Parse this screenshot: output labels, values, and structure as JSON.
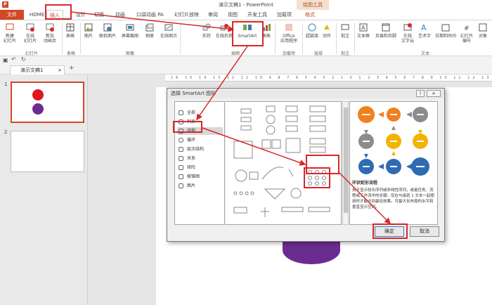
{
  "window": {
    "title": "演示文稿1 - PowerPoint",
    "context_tab_group": "绘图工具"
  },
  "tabs": [
    {
      "label": "文件"
    },
    {
      "label": "HOME"
    },
    {
      "label": "插入"
    },
    {
      "label": "设计"
    },
    {
      "label": "切换"
    },
    {
      "label": "动画"
    },
    {
      "label": "口袋动画 PA"
    },
    {
      "label": "幻灯片放映"
    },
    {
      "label": "审阅"
    },
    {
      "label": "视图"
    },
    {
      "label": "开发工具"
    },
    {
      "label": "加载项"
    },
    {
      "label": "格式"
    }
  ],
  "ribbon": {
    "buttons": [
      {
        "label": "新建\n幻灯片"
      },
      {
        "label": "在线\n幻灯片"
      },
      {
        "label": "新加\n动画页"
      },
      {
        "label": "表格"
      },
      {
        "label": "图片"
      },
      {
        "label": "联机图片"
      },
      {
        "label": "屏幕截图"
      },
      {
        "label": "相册"
      },
      {
        "label": "在线图示"
      },
      {
        "label": "形状"
      },
      {
        "label": "在线形状"
      },
      {
        "label": "SmartArt"
      },
      {
        "label": "图表"
      },
      {
        "label": "Office\n应用程序"
      },
      {
        "label": "超链接"
      },
      {
        "label": "动作"
      },
      {
        "label": "批注"
      },
      {
        "label": "文本框"
      },
      {
        "label": "页眉和页脚"
      },
      {
        "label": "在线\n文字云"
      },
      {
        "label": "艺术字"
      },
      {
        "label": "日期和时间"
      },
      {
        "label": "幻灯片\n编号"
      },
      {
        "label": "对象"
      }
    ],
    "groups": [
      "幻灯片",
      "表格",
      "图像",
      "插图",
      "加载项",
      "链接",
      "批注",
      "文本"
    ]
  },
  "document_tab": "演示文稿1",
  "slides": [
    {
      "number": "1"
    },
    {
      "number": "2"
    }
  ],
  "ruler_text": "16 15 14 13 12 11 10 9 8 7 6 5 4 3 2 1 0 1 2 3 4 5 6 7 8 9 10 11 12 13 14 15 16",
  "dialog": {
    "title": "选择 SmartArt 图形",
    "help_label": "?",
    "close_label": "✕",
    "categories": [
      {
        "label": "全部"
      },
      {
        "label": "列表"
      },
      {
        "label": "流程"
      },
      {
        "label": "循环"
      },
      {
        "label": "层次结构"
      },
      {
        "label": "关系"
      },
      {
        "label": "矩阵"
      },
      {
        "label": "棱锥图"
      },
      {
        "label": "图片"
      }
    ],
    "selected_category": "流程",
    "preview_name": "环状蛇形流程",
    "preview_description": "用于显示较长序列或非线性序列，或者任务、流程或工作流中的步骤。仅在与级别 1 文本一起使用时才能达到最佳效果。可最大化布局的水平和垂直显示空间。",
    "ok_label": "确定",
    "cancel_label": "取消"
  },
  "colors": {
    "accent": "#d24726",
    "annotation_red": "#d8272d",
    "smartart_orange": "#f0801e",
    "smartart_gray": "#8c8c8c",
    "smartart_yellow": "#f2b400",
    "smartart_blue": "#2f6bb3",
    "purple": "#6b2c91"
  }
}
